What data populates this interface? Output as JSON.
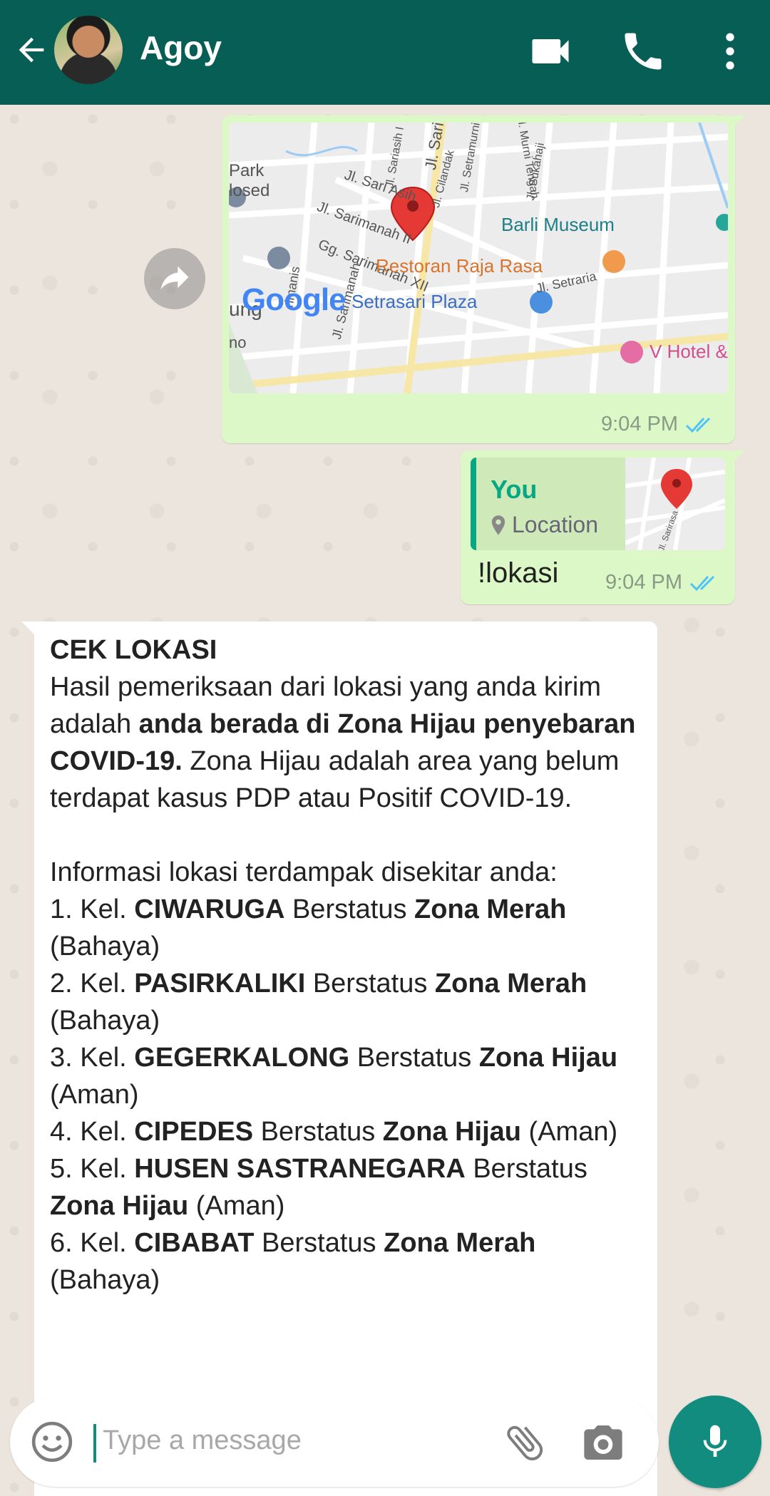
{
  "header": {
    "contact_name": "Agoy",
    "icons": [
      "back-arrow-icon",
      "video-call-icon",
      "phone-call-icon",
      "more-vert-icon"
    ]
  },
  "messages": {
    "map_message": {
      "time": "9:04 PM",
      "map_labels": [
        "Park",
        "losed",
        "Jl. Sari Asih",
        "Jl. Sarimanah II",
        "Gg. Sarimanah XII",
        "ung",
        "Jl. Sari",
        "Jl. Sariasih I",
        "Jl. Cilandak",
        "Jl. Setramurni",
        "Jl. Murni Tengah",
        "Jl. Sukahaji",
        "Barli Museum",
        "Restoran Raja Rasa",
        "Jl. Setraria",
        "Setrasari Plaza",
        "V Hotel &",
        "Jl. Sarimanah",
        "rimanis",
        "no"
      ],
      "map_logo": "Google"
    },
    "reply_message": {
      "quote_sender": "You",
      "quote_type": "Location",
      "text": "!lokasi",
      "time": "9:04 PM",
      "thumb_label": "Jl. Sarirasa"
    },
    "bot_message": {
      "title": "CEK LOKASI",
      "intro_1": "Hasil pemeriksaan dari lokasi yang anda kirim adalah ",
      "intro_bold": "anda berada di Zona Hijau penyebaran COVID-19.",
      "intro_2": " Zona Hijau adalah area yang belum terdapat kasus PDP atau Positif COVID-19.",
      "list_heading": "Informasi lokasi terdampak disekitar anda:",
      "items": [
        {
          "prefix": "1. Kel. ",
          "name": "CIWARUGA",
          "mid": " Berstatus ",
          "zone": "Zona Merah",
          "suffix": " (Bahaya)"
        },
        {
          "prefix": "2. Kel. ",
          "name": "PASIRKALIKI",
          "mid": " Berstatus ",
          "zone": "Zona Merah",
          "suffix": " (Bahaya)"
        },
        {
          "prefix": "3. Kel. ",
          "name": "GEGERKALONG",
          "mid": " Berstatus ",
          "zone": "Zona Hijau",
          "suffix": " (Aman)"
        },
        {
          "prefix": "4. Kel. ",
          "name": "CIPEDES",
          "mid": " Berstatus ",
          "zone": "Zona Hijau",
          "suffix": " (Aman)"
        },
        {
          "prefix": "5. Kel. ",
          "name": "HUSEN SASTRANEGARA",
          "mid": " Berstatus ",
          "zone": "Zona Hijau",
          "suffix": " (Aman)"
        },
        {
          "prefix": "6. Kel. ",
          "name": "CIBABAT",
          "mid": " Berstatus ",
          "zone": "Zona Merah",
          "suffix": " (Bahaya)"
        }
      ]
    }
  },
  "input": {
    "placeholder": "Type a message"
  },
  "colors": {
    "header": "#075e54",
    "outgoing": "#dcf8c6",
    "incoming": "#ffffff",
    "accent": "#128c7e",
    "ticks": "#4fc3f7"
  }
}
